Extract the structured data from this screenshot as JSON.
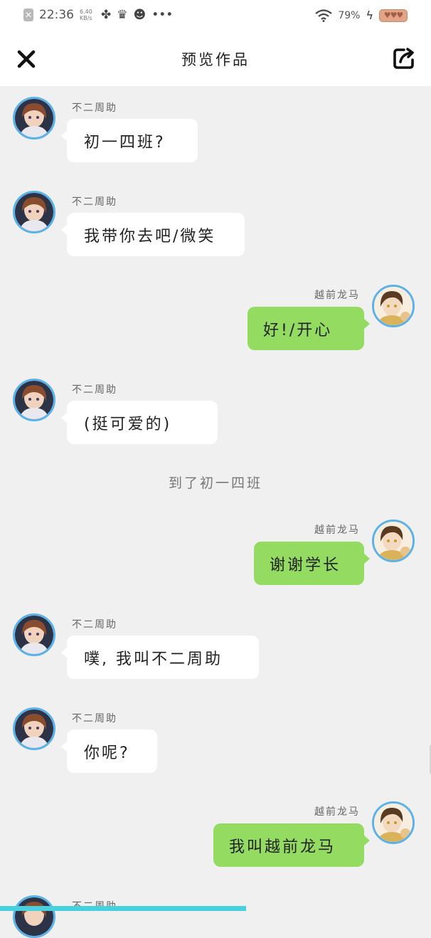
{
  "status_bar": {
    "time": "22:36",
    "net_speed": "6.40 KB/s",
    "battery_percent": "79%",
    "icons": [
      "notification-x-icon",
      "pinwheel-icon",
      "crown-icon",
      "ninja-face-icon",
      "more-dots-icon",
      "wifi-icon",
      "charging-bolt-icon",
      "battery-icon"
    ]
  },
  "header": {
    "title": "预览作品",
    "close_icon": "close-icon",
    "share_icon": "share-export-icon"
  },
  "characters": {
    "left": "不二周助",
    "right": "越前龙马"
  },
  "messages": [
    {
      "side": "left",
      "name": "不二周助",
      "text": "初一四班?"
    },
    {
      "side": "left",
      "name": "不二周助",
      "text": "我带你去吧/微笑"
    },
    {
      "side": "right",
      "name": "越前龙马",
      "text": "好!/开心"
    },
    {
      "side": "left",
      "name": "不二周助",
      "text": "(挺可爱的)"
    },
    {
      "side": "narration",
      "text": "到了初一四班"
    },
    {
      "side": "right",
      "name": "越前龙马",
      "text": "谢谢学长"
    },
    {
      "side": "left",
      "name": "不二周助",
      "text": "噗, 我叫不二周助"
    },
    {
      "side": "left",
      "name": "不二周助",
      "text": "你呢?"
    },
    {
      "side": "right",
      "name": "越前龙马",
      "text": "我叫越前龙马"
    },
    {
      "side": "left",
      "name": "不二周助",
      "text": ""
    }
  ],
  "colors": {
    "left_bubble": "#ffffff",
    "right_bubble": "#94db62",
    "avatar_ring": "#5bb2ea",
    "chat_bg": "#f0f0f0",
    "bottom_accent": "#48d0de"
  }
}
